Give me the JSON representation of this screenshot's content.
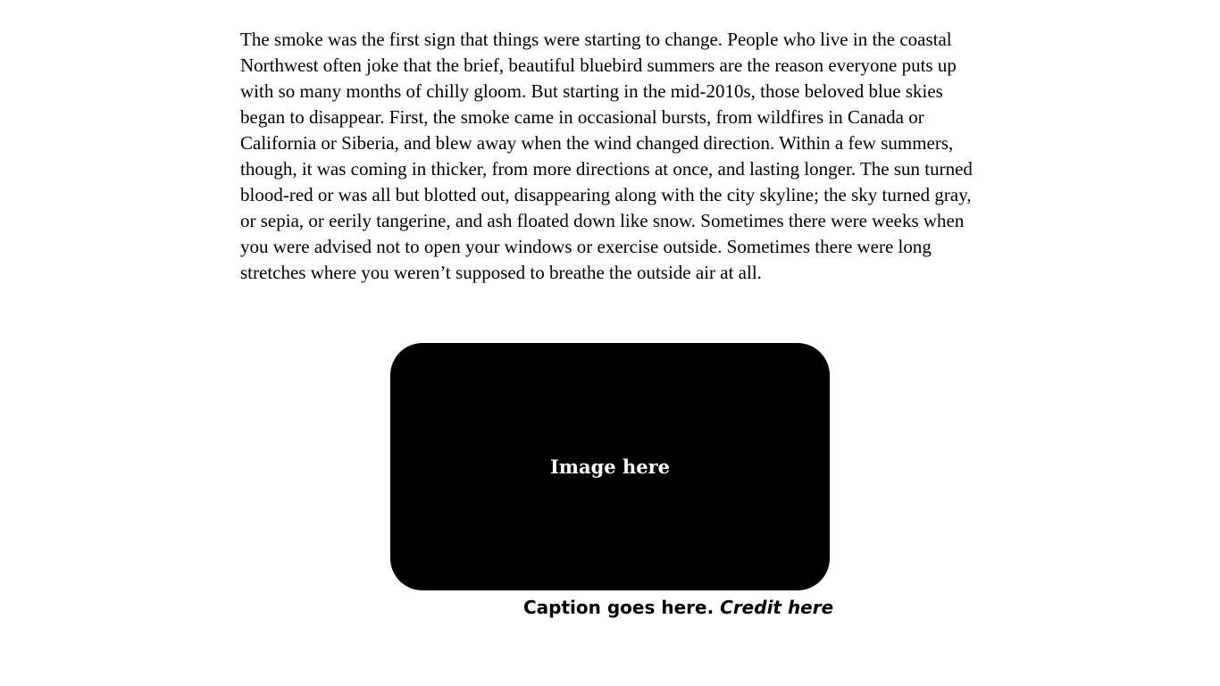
{
  "article": {
    "paragraph": "The smoke was the first sign that things were starting to change. People who live in the coastal Northwest often joke that the brief, beautiful bluebird summers are the reason everyone puts up with so many months of chilly gloom. But starting in the mid-2010s, those beloved blue skies began to disappear. First, the smoke came in occasional bursts, from wildfires in Canada or California or Siberia, and blew away when the wind changed direction. Within a few summers, though, it was coming in thicker, from more directions at once, and lasting longer. The sun turned blood-red or was all but blotted out, disappearing along with the city skyline; the sky turned gray, or sepia, or eerily tangerine, and ash floated down like snow. Sometimes there were weeks when you were advised not to open your windows or exercise outside. Sometimes there were long stretches where you weren’t supposed to breathe the outside air at all."
  },
  "figure": {
    "placeholder_text": "Image here",
    "caption": "Caption goes here.",
    "credit": "Credit here"
  },
  "colors": {
    "text": "#000000",
    "image_placeholder_bg": "#000000",
    "image_placeholder_text": "#ffffff"
  }
}
